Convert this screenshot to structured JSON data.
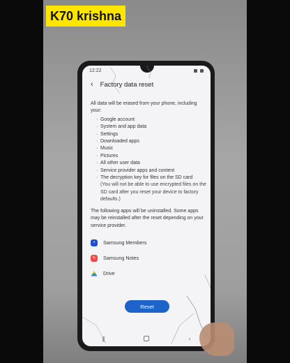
{
  "overlay": {
    "caption": "K70 krishna"
  },
  "status_bar": {
    "time": "12:22"
  },
  "screen": {
    "title": "Factory data reset",
    "intro": "All data will be erased from your phone, including your:",
    "items": [
      "Google account",
      "System and app data",
      "Settings",
      "Downloaded apps",
      "Music",
      "Pictures",
      "All other user data",
      "Service provider apps and content",
      "The decryption key for files on the SD card"
    ],
    "sd_note": "(You will not be able to use encrypted files on the SD card after you reset your device to factory defaults.)",
    "apps_note": "The following apps will be uninstalled. Some apps may be reinstalled after the reset depending on your service provider.",
    "apps": [
      {
        "label": "Samsung Members",
        "icon": "samsung-members-icon",
        "color": "#1f4fd1"
      },
      {
        "label": "Samsung Notes",
        "icon": "samsung-notes-icon",
        "color": "#ef4a4a"
      },
      {
        "label": "Drive",
        "icon": "google-drive-icon",
        "color": "#2aa457"
      }
    ],
    "reset_label": "Reset",
    "accent_color": "#1e63c9"
  },
  "nav_icons": [
    "recents-icon",
    "home-icon",
    "back-icon"
  ]
}
